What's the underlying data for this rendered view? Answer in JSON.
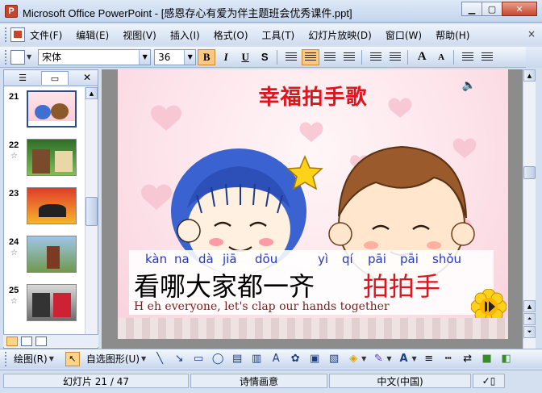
{
  "window": {
    "title": "Microsoft Office PowerPoint - [感恩存心有爱为伴主题班会优秀课件.ppt]",
    "min_icon": "minimize-icon",
    "max_icon": "maximize-icon",
    "close_icon": "close-icon"
  },
  "menu": {
    "items": [
      "文件(F)",
      "编辑(E)",
      "视图(V)",
      "插入(I)",
      "格式(O)",
      "工具(T)",
      "幻灯片放映(D)",
      "窗口(W)",
      "帮助(H)"
    ],
    "close_glyph": "×"
  },
  "format_toolbar": {
    "font": "宋体",
    "size": "36",
    "bold": "B",
    "italic": "I",
    "underline": "U",
    "shadow": "S",
    "grow_font": "A",
    "shrink_font": "A"
  },
  "thumbnails": [
    {
      "num": "21",
      "selected": true,
      "star": false
    },
    {
      "num": "22",
      "selected": false,
      "star": true
    },
    {
      "num": "23",
      "selected": false,
      "star": false
    },
    {
      "num": "24",
      "selected": false,
      "star": true
    },
    {
      "num": "25",
      "selected": false,
      "star": true
    }
  ],
  "slide": {
    "title": "幸福拍手歌",
    "pinyin": [
      "kàn",
      "na",
      "dà",
      "jiā",
      "dōu",
      "yì",
      "qí",
      "pāi",
      "pāi",
      "shǒu"
    ],
    "hanzi_black": "看哪大家都一齐",
    "hanzi_red": "拍拍手",
    "english": "H eh everyone, let's clap our hands together"
  },
  "draw_toolbar": {
    "draw_label": "绘图(R)",
    "autoshape_label": "自选图形(U)"
  },
  "status": {
    "slide_pos": "幻灯片 21 / 47",
    "theme": "诗情画意",
    "language": "中文(中国)"
  },
  "colors": {
    "title_red": "#e0141c",
    "pinyin_blue": "#2337c8",
    "accent_orange": "#ffc880"
  }
}
